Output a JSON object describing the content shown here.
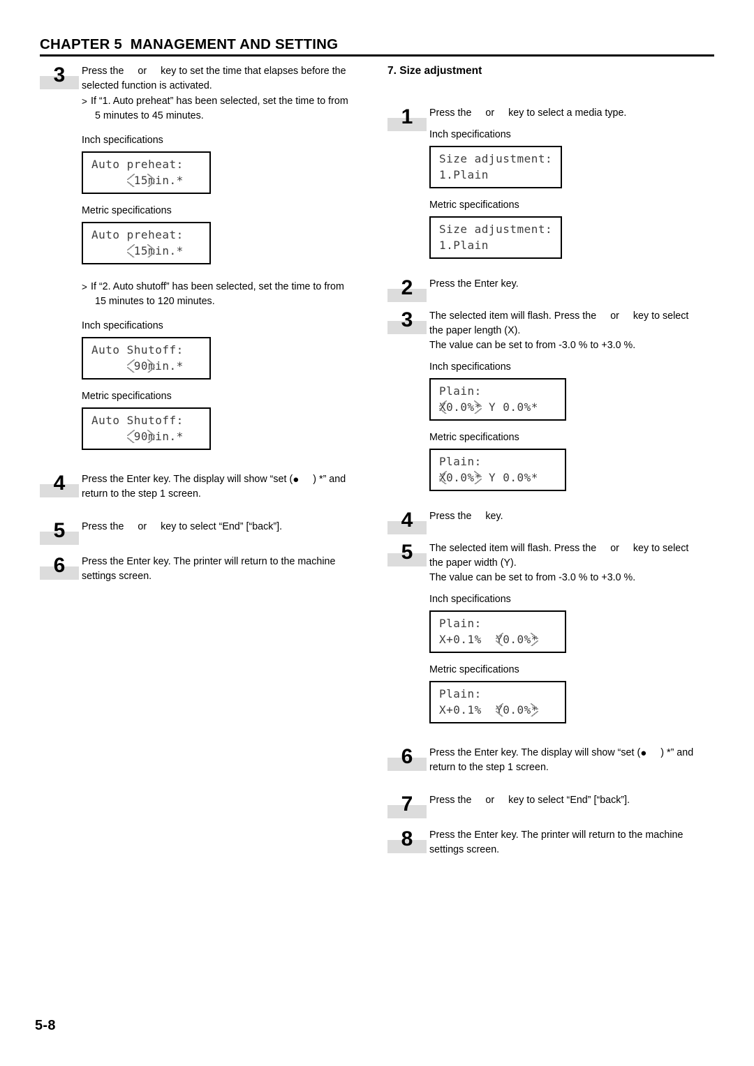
{
  "header": {
    "chapter_title": "CHAPTER 5  MANAGEMENT AND SETTING"
  },
  "footer": {
    "page_number": "5-8"
  },
  "left_column": {
    "steps": [
      {
        "number": "3",
        "text_a": "Press the",
        "text_or": "or",
        "text_b": "key to set the time that elapses before the",
        "text_c": "selected function is activated."
      },
      {
        "number": "4",
        "text_a": "Press the Enter key. The display will show “set (",
        "text_b": ") *” and",
        "text_c": "return to the step 1 screen."
      },
      {
        "number": "5",
        "text_a": "Press the",
        "text_or": "or",
        "text_b": "key to select “End” [“back”]."
      },
      {
        "number": "6",
        "text_a": "Press the Enter key. The printer will return to the machine",
        "text_b": "settings screen."
      }
    ],
    "note_preheat": {
      "marker": ">",
      "line1": "If “1. Auto preheat” has been selected, set the time to from",
      "line2": "5 minutes to 45 minutes."
    },
    "note_shutoff": {
      "marker": ">",
      "line1": "If “2. Auto shutoff” has been selected, set the time to from",
      "line2": "15 minutes to 120 minutes."
    },
    "spec_inch": "Inch specifications",
    "spec_metric": "Metric specifications",
    "lcd_preheat_inch": {
      "line1": "Auto preheat:",
      "line2_pad": "      ",
      "line2_value": "15",
      "line2_tail": "min.*"
    },
    "lcd_preheat_metric": {
      "line1": "Auto preheat:",
      "line2_pad": "      ",
      "line2_value": "15",
      "line2_tail": "min.*"
    },
    "lcd_shutoff_inch": {
      "line1": "Auto Shutoff:",
      "line2_pad": "      ",
      "line2_value": "90",
      "line2_tail": "min.*"
    },
    "lcd_shutoff_metric": {
      "line1": "Auto Shutoff:",
      "line2_pad": "      ",
      "line2_value": "90",
      "line2_tail": "min.*"
    }
  },
  "right_column": {
    "section_heading": "7. Size adjustment",
    "spec_inch": "Inch specifications",
    "spec_metric": "Metric specifications",
    "steps": [
      {
        "number": "1",
        "text_a": "Press the",
        "text_or": "or",
        "text_b": "key to select a media type."
      },
      {
        "number": "2",
        "text_a": "Press the Enter key."
      },
      {
        "number": "3",
        "text_a": "The selected item will flash. Press the",
        "text_or": "or",
        "text_b": "key to select",
        "text_c": "the paper length (X).",
        "text_d": "The value can be set to from -3.0 % to +3.0 %."
      },
      {
        "number": "4",
        "text_a": "Press the",
        "text_b": "key."
      },
      {
        "number": "5",
        "text_a": "The selected item will flash. Press the",
        "text_or": "or",
        "text_b": "key to select",
        "text_c": "the paper width (Y).",
        "text_d": "The value can be set to from -3.0 % to +3.0 %."
      },
      {
        "number": "6",
        "text_a": "Press the Enter key. The display will show “set (",
        "text_b": ") *” and",
        "text_c": "return to the step 1 screen."
      },
      {
        "number": "7",
        "text_a": "Press the",
        "text_or": "or",
        "text_b": "key to select “End” [“back”]."
      },
      {
        "number": "8",
        "text_a": "Press the Enter key. The printer will return to the machine",
        "text_b": "settings screen."
      }
    ],
    "lcd_size_inch": {
      "line1": "Size adjustment:",
      "line2": "1.Plain"
    },
    "lcd_size_metric": {
      "line1": "Size adjustment:",
      "line2": "1.Plain"
    },
    "lcd_x_inch": {
      "line1": "Plain:",
      "line2_prefix": "X",
      "line2_value": "0.0%",
      "line2_tail": "* Y 0.0%*"
    },
    "lcd_x_metric": {
      "line1": "Plain:",
      "line2_prefix": "X",
      "line2_value": "0.0%",
      "line2_tail": "* Y 0.0%*"
    },
    "lcd_y_inch": {
      "line1": "Plain:",
      "line2_prefix": "X+0.1%  Y",
      "line2_value": "0.0%",
      "line2_tail": "*"
    },
    "lcd_y_metric": {
      "line1": "Plain:",
      "line2_prefix": "X+0.1%  Y",
      "line2_value": "0.0%",
      "line2_tail": "*"
    }
  }
}
